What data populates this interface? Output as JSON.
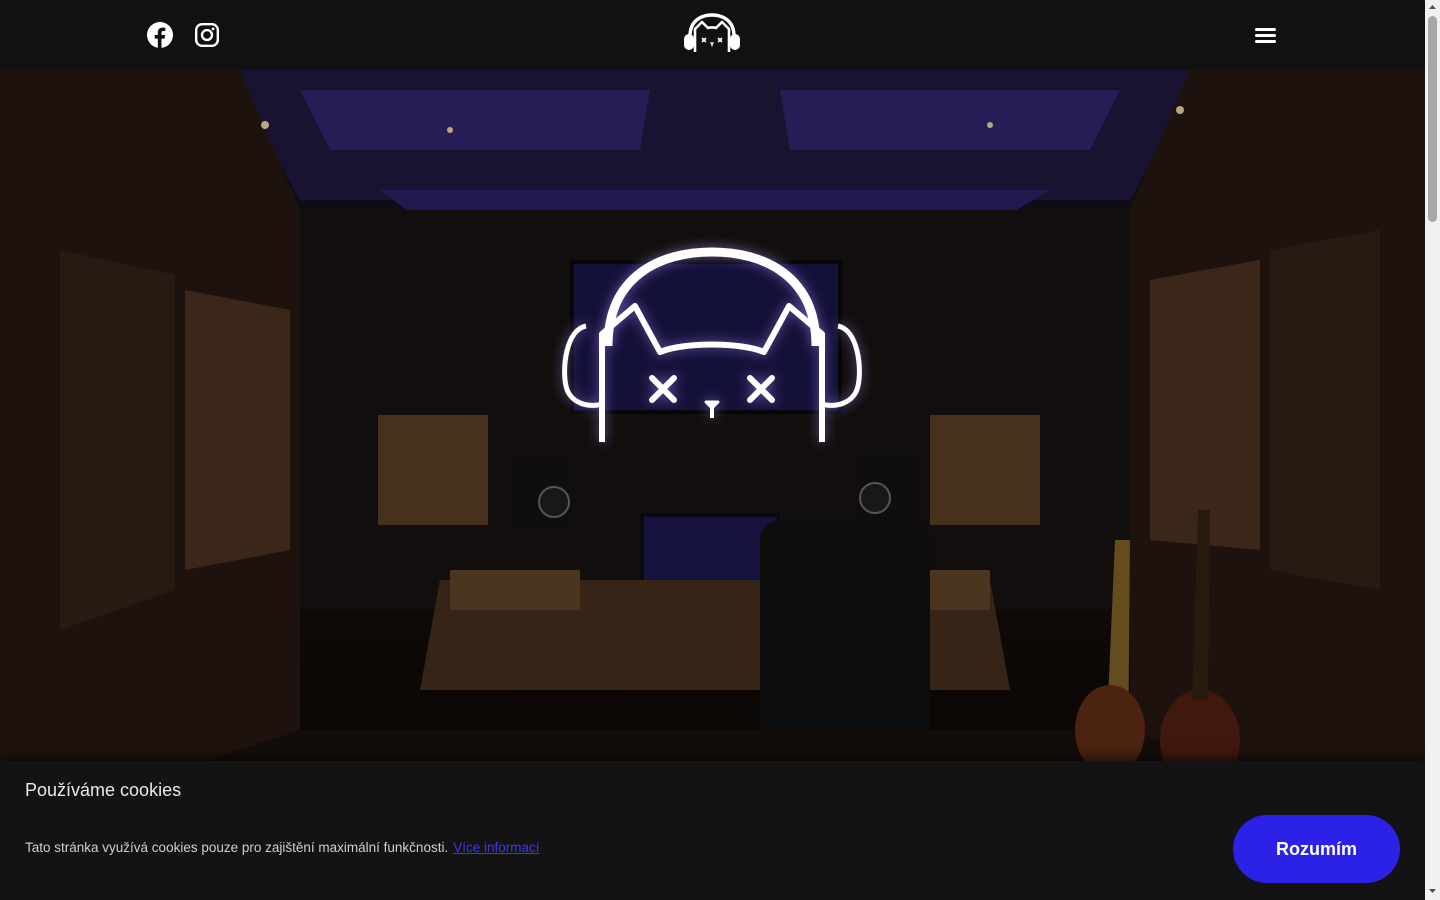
{
  "header": {
    "social": [
      {
        "icon": "facebook-icon",
        "label": "Facebook"
      },
      {
        "icon": "instagram-icon",
        "label": "Instagram"
      }
    ],
    "logo_icon": "cat-headphones-logo",
    "menu_icon": "hamburger-menu-icon"
  },
  "hero": {
    "logo_icon": "cat-headphones-logo-large"
  },
  "cookie_bar": {
    "title": "Používáme cookies",
    "text": "Tato stránka využívá cookies pouze pro zajištění maximální funkčnosti.",
    "link_text": "Více informací",
    "accept_label": "Rozumím"
  },
  "colors": {
    "header_bg": "#111111",
    "accent": "#2c21e6",
    "link": "#3c38f0",
    "cookie_bg": "#131313"
  }
}
